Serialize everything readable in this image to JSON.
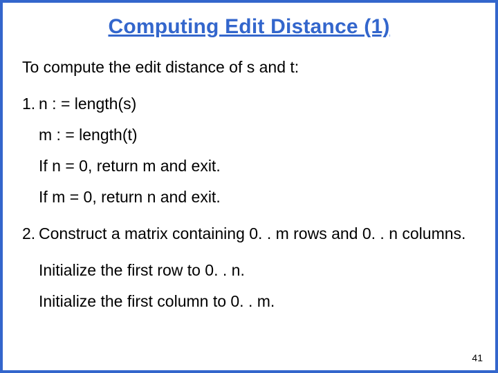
{
  "title": "Computing Edit Distance (1)",
  "intro": "To compute the edit distance of s and t:",
  "step1": {
    "num": "1.",
    "l1_txt": "n : = length(s)",
    "l2": "m : = length(t)",
    "l3": "If n = 0, return m and exit.",
    "l4": "If m = 0, return n and exit."
  },
  "step2": {
    "num": "2.",
    "l1_txt": "Construct a matrix containing 0. . m rows and 0. . n columns.",
    "l2": "Initialize the first row to 0. . n.",
    "l3": "Initialize the first column to 0. . m."
  },
  "pagenum": "41"
}
